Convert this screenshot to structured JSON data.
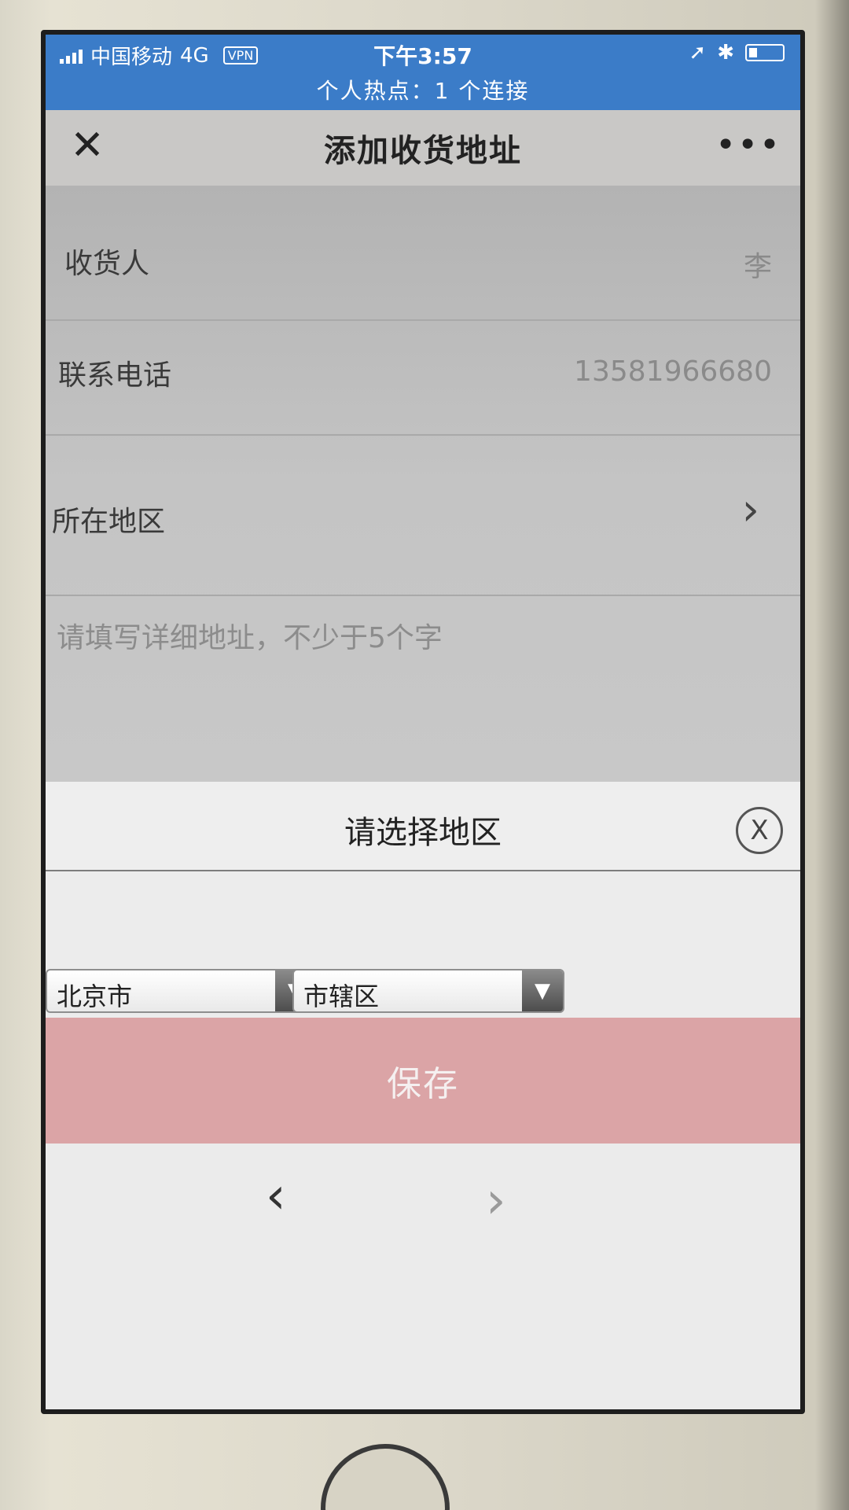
{
  "statusbar": {
    "carrier": "中国移动",
    "network": "4G",
    "vpn": "VPN",
    "time": "下午3:57",
    "hotspot": "个人热点：1 个连接"
  },
  "navbar": {
    "title": "添加收货地址",
    "more": "•••"
  },
  "form": {
    "recipient_label": "收货人",
    "recipient_value": "李",
    "phone_label": "联系电话",
    "phone_value": "13581966680",
    "region_label": "所在地区",
    "address_placeholder": "请填写详细地址，不少于5个字"
  },
  "region_picker": {
    "title": "请选择地区",
    "close": "X",
    "province": "北京市",
    "district": "市辖区"
  },
  "actions": {
    "save": "保存"
  },
  "browser_nav": {
    "back": "‹",
    "forward": "›"
  }
}
